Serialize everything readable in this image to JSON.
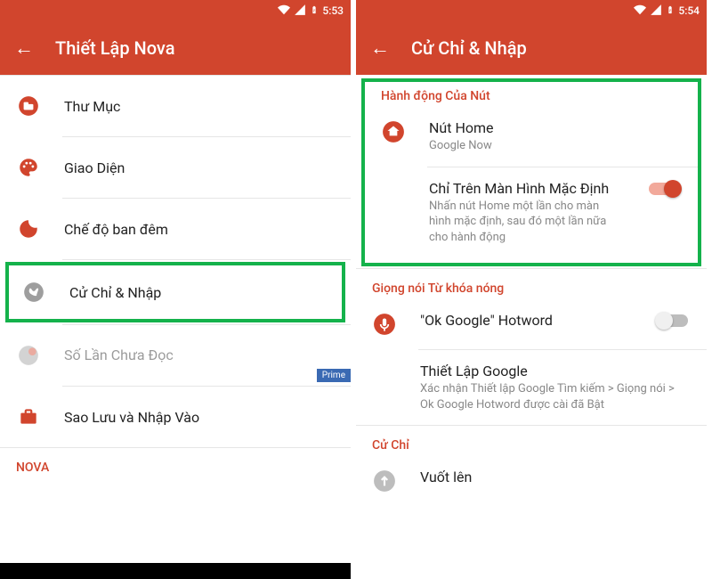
{
  "colors": {
    "accent": "#d1452d",
    "highlight": "#14b24b",
    "prime": "#3a6ab3"
  },
  "left": {
    "status_time": "5:53",
    "title": "Thiết Lập Nova",
    "items": {
      "folder": "Thư Mục",
      "look": "Giao Diện",
      "night": "Chế độ ban đêm",
      "gestures": "Cử Chỉ & Nhập",
      "unread": "Số Lần Chưa Đọc",
      "prime_badge": "Prime",
      "backup": "Sao Lưu và Nhập Vào"
    },
    "section_nova": "NOVA"
  },
  "right": {
    "status_time": "5:54",
    "title": "Cử Chỉ & Nhập",
    "sections": {
      "button_actions": "Hành động Của Nút",
      "hotword": "Giọng nói Từ khóa nóng",
      "gestures": "Cử Chỉ"
    },
    "home": {
      "primary": "Nút Home",
      "secondary": "Google Now"
    },
    "default_only": {
      "primary": "Chỉ Trên Màn Hình Mặc Định",
      "secondary": "Nhấn nút Home một lần cho màn hình mặc định, sau đó một lần nữa cho hành động"
    },
    "ok_google": {
      "primary": "\"Ok Google\" Hotword"
    },
    "google_setup": {
      "primary": "Thiết Lập Google",
      "secondary": "Xác nhận Thiết lập Google Tìm kiếm > Giọng nói > Ok Google Hotword được cài đã Bật"
    },
    "swipe_up": {
      "primary": "Vuốt lên"
    }
  }
}
